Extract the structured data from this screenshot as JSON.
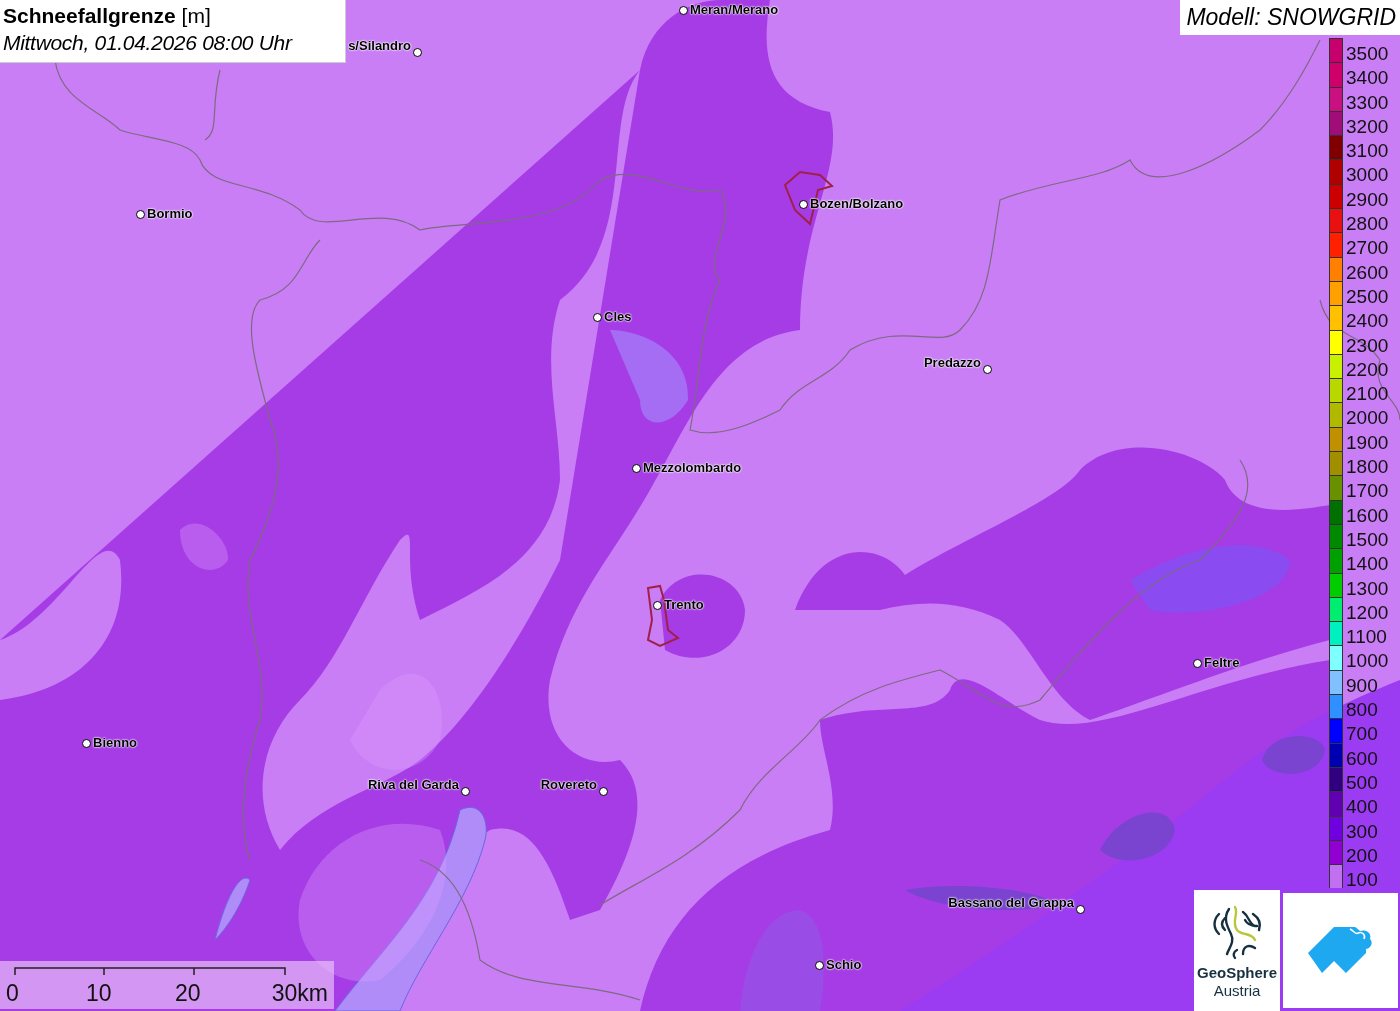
{
  "title": {
    "heading": "**Schneefallgrenze** [m]",
    "time": "Mittwoch, 01.04.2026 08:00 Uhr"
  },
  "model_label": "Modell: SNOWGRID",
  "legend": [
    {
      "label": "3500",
      "color": "#c8006e"
    },
    {
      "label": "3400",
      "color": "#d0006a"
    },
    {
      "label": "3300",
      "color": "#c81080"
    },
    {
      "label": "3200",
      "color": "#a00c78"
    },
    {
      "label": "3100",
      "color": "#800000"
    },
    {
      "label": "3000",
      "color": "#b00000"
    },
    {
      "label": "2900",
      "color": "#cc0000"
    },
    {
      "label": "2800",
      "color": "#e81010"
    },
    {
      "label": "2700",
      "color": "#ff2000"
    },
    {
      "label": "2600",
      "color": "#ff8000"
    },
    {
      "label": "2500",
      "color": "#ffa000"
    },
    {
      "label": "2400",
      "color": "#ffc000"
    },
    {
      "label": "2300",
      "color": "#ffff00"
    },
    {
      "label": "2200",
      "color": "#c8f000"
    },
    {
      "label": "2100",
      "color": "#b8d800"
    },
    {
      "label": "2000",
      "color": "#b0b800"
    },
    {
      "label": "1900",
      "color": "#c09000"
    },
    {
      "label": "1800",
      "color": "#a09000"
    },
    {
      "label": "1700",
      "color": "#689000"
    },
    {
      "label": "1600",
      "color": "#007000"
    },
    {
      "label": "1500",
      "color": "#008800"
    },
    {
      "label": "1400",
      "color": "#00a000"
    },
    {
      "label": "1300",
      "color": "#00cc00"
    },
    {
      "label": "1200",
      "color": "#00ee70"
    },
    {
      "label": "1100",
      "color": "#00f0c0"
    },
    {
      "label": "1000",
      "color": "#80ffff"
    },
    {
      "label": "900",
      "color": "#80c0ff"
    },
    {
      "label": "800",
      "color": "#3090ff"
    },
    {
      "label": "700",
      "color": "#0000ff"
    },
    {
      "label": "600",
      "color": "#0000b0"
    },
    {
      "label": "500",
      "color": "#300080"
    },
    {
      "label": "400",
      "color": "#6000b0"
    },
    {
      "label": "300",
      "color": "#7000e0"
    },
    {
      "label": "200",
      "color": "#9000d0"
    },
    {
      "label": "100",
      "color": "#c070f0"
    }
  ],
  "places": [
    {
      "name": "Meran/Merano"
    },
    {
      "name": "s/Silandro"
    },
    {
      "name": "Bormio"
    },
    {
      "name": "Bozen/Bolzano"
    },
    {
      "name": "Cles"
    },
    {
      "name": "Predazzo"
    },
    {
      "name": "Mezzolombardo"
    },
    {
      "name": "Trento"
    },
    {
      "name": "Feltre"
    },
    {
      "name": "Bienno"
    },
    {
      "name": "Riva del Garda"
    },
    {
      "name": "Rovereto"
    },
    {
      "name": "Bassano del Grappa"
    },
    {
      "name": "Schio"
    }
  ],
  "scale_bar": {
    "ticks": [
      "0",
      "10",
      "20",
      "30km"
    ]
  },
  "logo": {
    "name": "GeoSphere",
    "subtitle": "Austria"
  }
}
